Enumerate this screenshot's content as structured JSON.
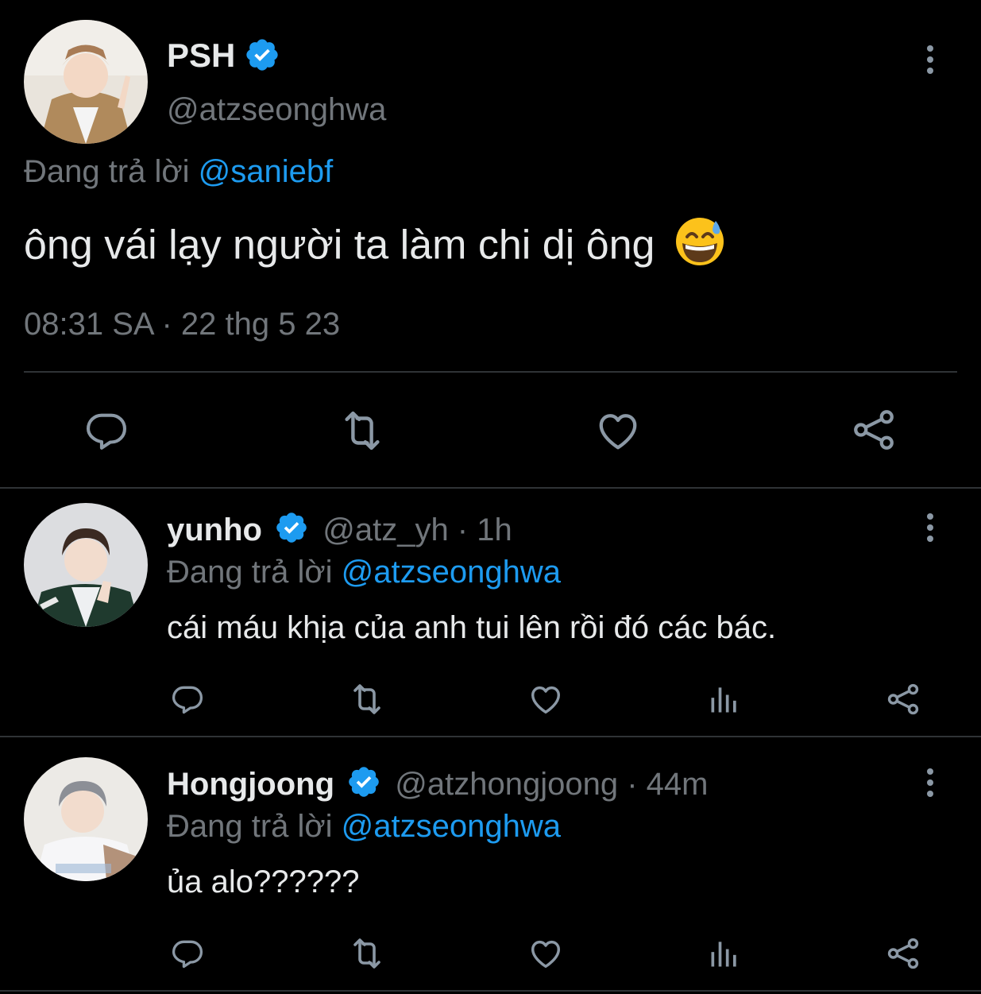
{
  "main_tweet": {
    "author_name": "PSH",
    "handle": "@atzseonghwa",
    "reply_prefix": "Đang trả lời",
    "reply_to": "@saniebf",
    "text": "ông vái lạy người ta làm chi dị ông",
    "emoji": "grinning-face-with-sweat",
    "timestamp": "08:31 SA · 22 thg 5 23"
  },
  "replies": [
    {
      "author_name": "yunho",
      "handle_time": "@atz_yh · 1h",
      "reply_prefix": "Đang trả lời",
      "reply_to": "@atzseonghwa",
      "text": "cái máu khịa của anh tui lên rồi đó các bác."
    },
    {
      "author_name": "Hongjoong",
      "handle_time": "@atzhongjoong · 44m",
      "reply_prefix": "Đang trả lời",
      "reply_to": "@atzseonghwa",
      "text": "ủa alo??????"
    }
  ],
  "colors": {
    "background": "#000000",
    "accent": "#1d9bf0",
    "muted": "#71767b",
    "text": "#e7e9ea"
  }
}
